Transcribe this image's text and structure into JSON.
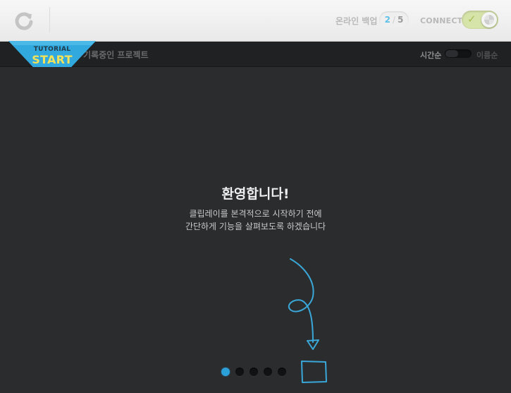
{
  "header": {
    "refresh_icon": "refresh-icon",
    "backup_label": "온라인 백업",
    "backup_current": "2",
    "backup_separator": "/",
    "backup_total": "5",
    "connect_label": "CONNECT",
    "connect_on": true
  },
  "subbar": {
    "project_title": "기록중인 프로젝트",
    "sort_time_label": "시간순",
    "sort_name_label": "이름순"
  },
  "tutorial": {
    "small_label": "TUTORIAL",
    "big_label": "START"
  },
  "welcome": {
    "title": "환영합니다!",
    "line1": "클립레이를 본격적으로 시작하기 전에",
    "line2": "간단하게 기능을 살펴보도록 하겠습니다"
  },
  "pager": {
    "total": 5,
    "active_index": 0
  },
  "colors": {
    "accent_blue": "#2a9fd8",
    "badge_blue": "#31a9de",
    "badge_text_yellow": "#f3e25a",
    "toggle_green": "#d6e3a9"
  }
}
